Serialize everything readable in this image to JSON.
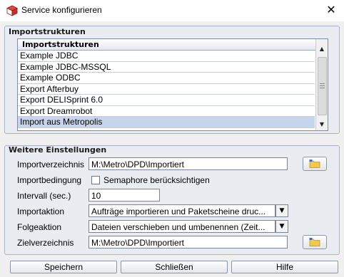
{
  "window": {
    "title": "Service konfigurieren",
    "close_icon": "close-icon"
  },
  "import_group": {
    "title": "Importstrukturen",
    "list_header": "Importstrukturen",
    "items": [
      "Example JDBC",
      "Example JDBC-MSSQL",
      "Example ODBC",
      "Export Afterbuy",
      "Export DELISprint 6.0",
      "Export Dreamrobot",
      "Import aus Metropolis"
    ],
    "selected": "Import aus Metropolis"
  },
  "settings_group": {
    "title": "Weitere Einstellungen",
    "import_dir": {
      "label": "Importverzeichnis",
      "value": "M:\\Metro\\DPD\\Importiert"
    },
    "import_condition": {
      "label": "Importbedingung",
      "checkbox_label": "Semaphore berücksichtigen",
      "checked": false
    },
    "interval": {
      "label": "Intervall (sec.)",
      "value": "10"
    },
    "import_action": {
      "label": "Importaktion",
      "value": "Aufträge importieren und Paketscheine druc..."
    },
    "follow_action": {
      "label": "Folgeaktion",
      "value": "Dateien verschieben und umbenennen (Zeit..."
    },
    "target_dir": {
      "label": "Zielverzeichnis",
      "value": "M:\\Metro\\DPD\\Importiert"
    }
  },
  "buttons": {
    "save": "Speichern",
    "close": "Schließen",
    "help": "Hilfe"
  },
  "colors": {
    "selection": "#c7d4ec",
    "group_bg": "#e9ecf1",
    "folder": "#f2c94c"
  }
}
